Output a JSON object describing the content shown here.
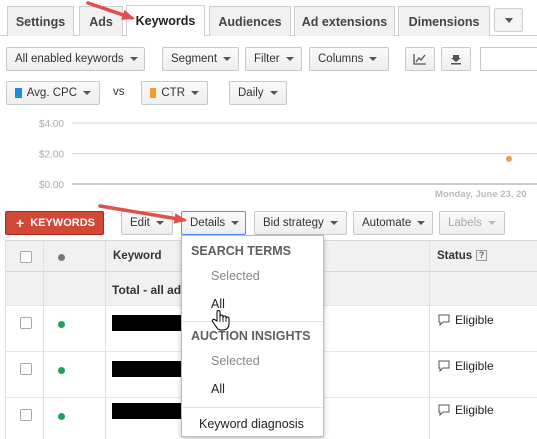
{
  "tabs": [
    {
      "label": "Settings"
    },
    {
      "label": "Ads"
    },
    {
      "label": "Keywords"
    },
    {
      "label": "Audiences"
    },
    {
      "label": "Ad extensions"
    },
    {
      "label": "Dimensions"
    }
  ],
  "active_tab": "Keywords",
  "toolbar": {
    "filter_select": "All enabled keywords",
    "segment": "Segment",
    "filter": "Filter",
    "columns": "Columns",
    "chart_icon": "line-chart-icon",
    "download_icon": "download-icon"
  },
  "metrics": {
    "metric1": {
      "label": "Avg. CPC",
      "color": "#1a8ed6"
    },
    "vs": "vs",
    "metric2": {
      "label": "CTR",
      "color": "#f39c2a"
    },
    "interval": "Daily"
  },
  "chart_data": {
    "type": "scatter",
    "y_tick_labels": [
      "$4.00",
      "$2.00",
      "$0.00"
    ],
    "ylim": [
      0,
      4
    ],
    "x_label_visible": "Monday, June 23, 20",
    "series": [
      {
        "values": [
          {
            "x": 0.97,
            "y": 1.65
          }
        ],
        "color": "#e8a14a"
      }
    ],
    "grid": true
  },
  "keyword_toolbar": {
    "add_keywords": "KEYWORDS",
    "edit": "Edit",
    "details": "Details",
    "bid_strategy": "Bid strategy",
    "automate": "Automate",
    "labels": "Labels"
  },
  "table": {
    "headers": {
      "keyword": "Keyword",
      "status": "Status",
      "help": "?"
    },
    "total_label": "Total - all ad",
    "rows": [
      {
        "status": "Eligible",
        "dot_color": "#1aa260"
      },
      {
        "status": "Eligible",
        "dot_color": "#1aa260"
      },
      {
        "status": "Eligible",
        "dot_color": "#1aa260"
      }
    ],
    "header_dot_color": "#777777"
  },
  "details_menu": {
    "search_terms": {
      "title": "SEARCH TERMS",
      "selected": "Selected",
      "all": "All"
    },
    "auction_insights": {
      "title": "AUCTION INSIGHTS",
      "selected": "Selected",
      "all": "All"
    },
    "keyword_diagnosis": "Keyword diagnosis"
  },
  "annotation_color": "#e0504a"
}
